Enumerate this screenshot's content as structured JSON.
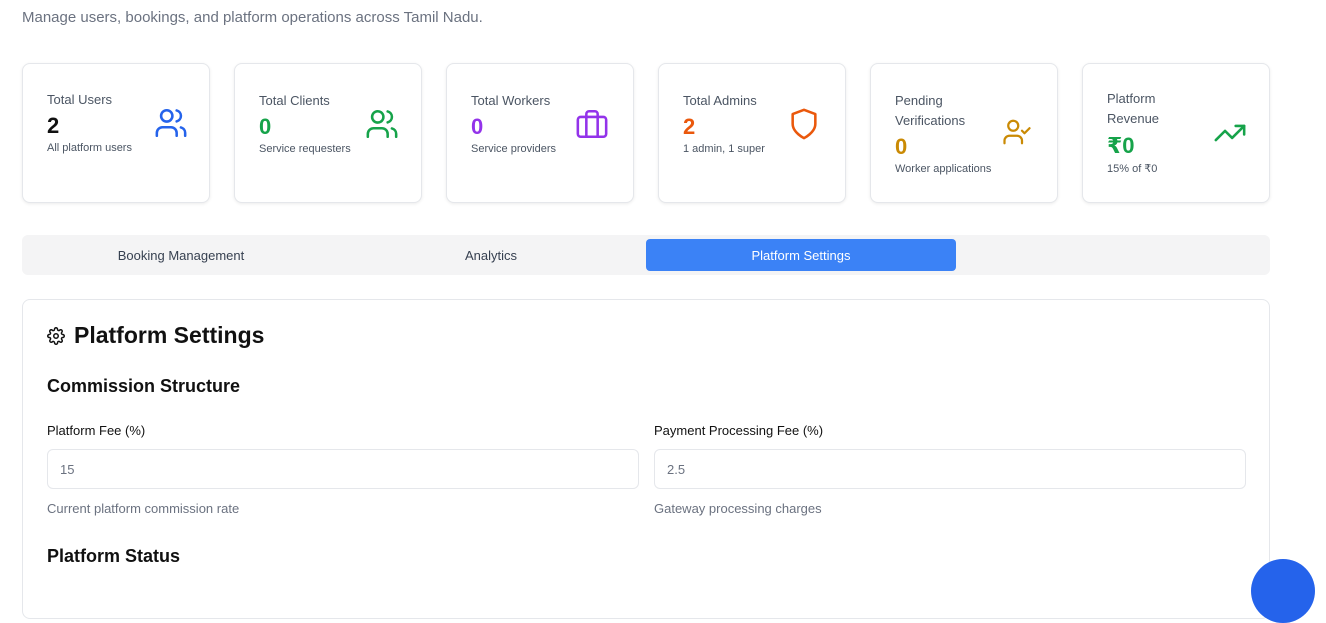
{
  "header": {
    "subtitle": "Manage users, bookings, and platform operations across Tamil Nadu."
  },
  "stats": {
    "total_users": {
      "label": "Total Users",
      "value": "2",
      "desc": "All platform users",
      "icon": "users-icon",
      "color": "#2563eb"
    },
    "total_clients": {
      "label": "Total Clients",
      "value": "0",
      "desc": "Service requesters",
      "icon": "users-icon",
      "color": "#16a34a"
    },
    "total_workers": {
      "label": "Total Workers",
      "value": "0",
      "desc": "Service providers",
      "icon": "briefcase-icon",
      "color": "#9333ea"
    },
    "total_admins": {
      "label": "Total Admins",
      "value": "2",
      "desc": "1 admin, 1 super",
      "icon": "shield-icon",
      "color": "#ea580c"
    },
    "pending_verifications": {
      "label_line1": "Pending",
      "label_line2": "Verifications",
      "value": "0",
      "desc": "Worker applications",
      "icon": "user-check-icon",
      "color": "#ca8a04"
    },
    "platform_revenue": {
      "label_line1": "Platform",
      "label_line2": "Revenue",
      "value": "₹0",
      "desc": "15% of ₹0",
      "icon": "trending-up-icon",
      "color": "#16a34a"
    }
  },
  "tabs": [
    {
      "label": "Booking Management",
      "active": false
    },
    {
      "label": "Analytics",
      "active": false
    },
    {
      "label": "Platform Settings",
      "active": true
    }
  ],
  "settings": {
    "title": "Platform Settings",
    "icon": "gear-icon",
    "commission": {
      "title": "Commission Structure",
      "platform_fee": {
        "label": "Platform Fee (%)",
        "value": "15",
        "help": "Current platform commission rate"
      },
      "processing_fee": {
        "label": "Payment Processing Fee (%)",
        "value": "2.5",
        "help": "Gateway processing charges"
      }
    },
    "status": {
      "title": "Platform Status"
    }
  },
  "colors": {
    "accent": "#3b82f6"
  }
}
